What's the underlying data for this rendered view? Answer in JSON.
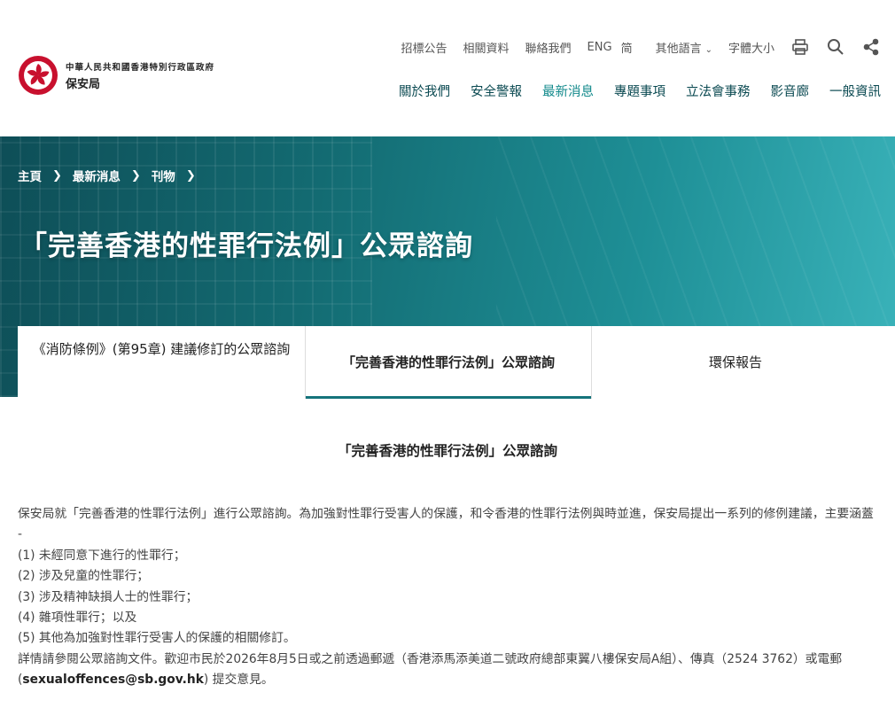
{
  "header": {
    "logo_line1": "中華人民共和國香港特別行政區政府",
    "logo_line2": "保安局",
    "utility": {
      "tender": "招標公告",
      "related": "相關資料",
      "contact": "聯絡我們",
      "eng": "ENG",
      "simplified": "简",
      "other_lang": "其他語言",
      "font_size": "字體大小"
    },
    "nav": [
      "關於我們",
      "安全警報",
      "最新消息",
      "專題事項",
      "立法會事務",
      "影音廊",
      "一般資訊"
    ],
    "nav_active_index": 2
  },
  "banner": {
    "breadcrumb": [
      "主頁",
      "最新消息",
      "刊物"
    ],
    "title": "「完善香港的性罪行法例」公眾諮詢"
  },
  "tabs": [
    {
      "label": "《消防條例》(第95章) 建議修訂的公眾諮詢"
    },
    {
      "label": "「完善香港的性罪行法例」公眾諮詢"
    },
    {
      "label": "環保報告"
    }
  ],
  "content": {
    "title": "「完善香港的性罪行法例」公眾諮詢",
    "intro": "保安局就「完善香港的性罪行法例」進行公眾諮詢。為加強對性罪行受害人的保護，和令香港的性罪行法例與時並進，保安局提出一系列的修例建議，主要涵蓋 -",
    "items": [
      "(1) 未經同意下進行的性罪行；",
      "(2) 涉及兒童的性罪行；",
      "(3) 涉及精神缺損人士的性罪行；",
      "(4) 雜項性罪行；以及",
      "(5) 其他為加強對性罪行受害人的保護的相關修訂。"
    ],
    "details_prefix": "詳情請參閱公眾諮詢文件。歡迎市民於2026年8月5日或之前透過郵遞（香港添馬添美道二號政府總部東翼八樓保安局A組）、傳真（2524 3762）或電郵 (",
    "email": "sexualoffences@sb.gov.hk",
    "details_suffix": ") 提交意見。"
  },
  "colors": {
    "accent": "#15737b",
    "nav_active": "#138a8c",
    "nav": "#0b4a52",
    "banner_start": "#0e4e57",
    "banner_end": "#3ab3ba"
  }
}
